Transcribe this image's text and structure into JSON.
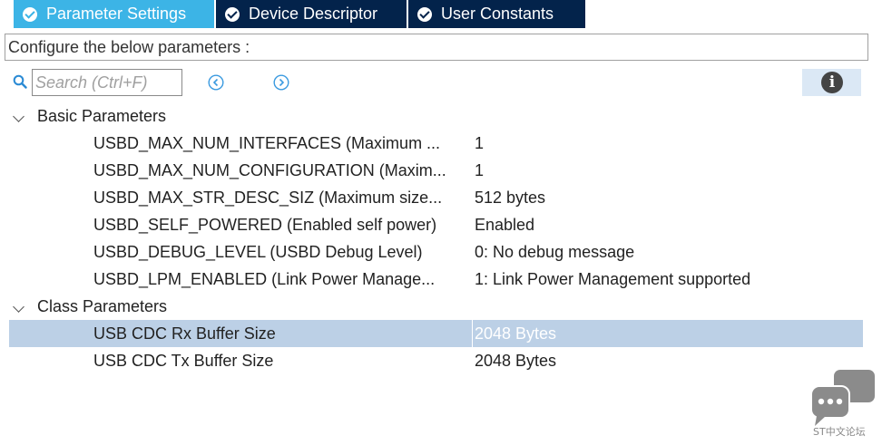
{
  "tabs": [
    {
      "label": "Parameter Settings",
      "active": true
    },
    {
      "label": "Device Descriptor",
      "active": false
    },
    {
      "label": "User Constants",
      "active": false
    }
  ],
  "configure_text": "Configure the below parameters :",
  "search": {
    "placeholder": "Search (Ctrl+F)"
  },
  "groups": [
    {
      "label": "Basic Parameters",
      "rows": [
        {
          "name": "USBD_MAX_NUM_INTERFACES (Maximum ...",
          "value": "1"
        },
        {
          "name": "USBD_MAX_NUM_CONFIGURATION (Maxim...",
          "value": "1"
        },
        {
          "name": "USBD_MAX_STR_DESC_SIZ (Maximum size...",
          "value": "512 bytes"
        },
        {
          "name": "USBD_SELF_POWERED (Enabled self power)",
          "value": "Enabled"
        },
        {
          "name": "USBD_DEBUG_LEVEL (USBD Debug Level)",
          "value": "0: No debug message"
        },
        {
          "name": "USBD_LPM_ENABLED (Link Power Manage...",
          "value": "1: Link Power Management supported"
        }
      ]
    },
    {
      "label": "Class Parameters",
      "rows": [
        {
          "name": "USB CDC Rx Buffer Size",
          "value": "2048 Bytes",
          "selected": true
        },
        {
          "name": "USB CDC Tx Buffer Size",
          "value": "2048 Bytes"
        }
      ]
    }
  ],
  "watermark": "ST中文论坛",
  "colors": {
    "tab_active": "#3cb4e6",
    "tab_inactive": "#03234b",
    "selection": "#bcd0e6"
  }
}
